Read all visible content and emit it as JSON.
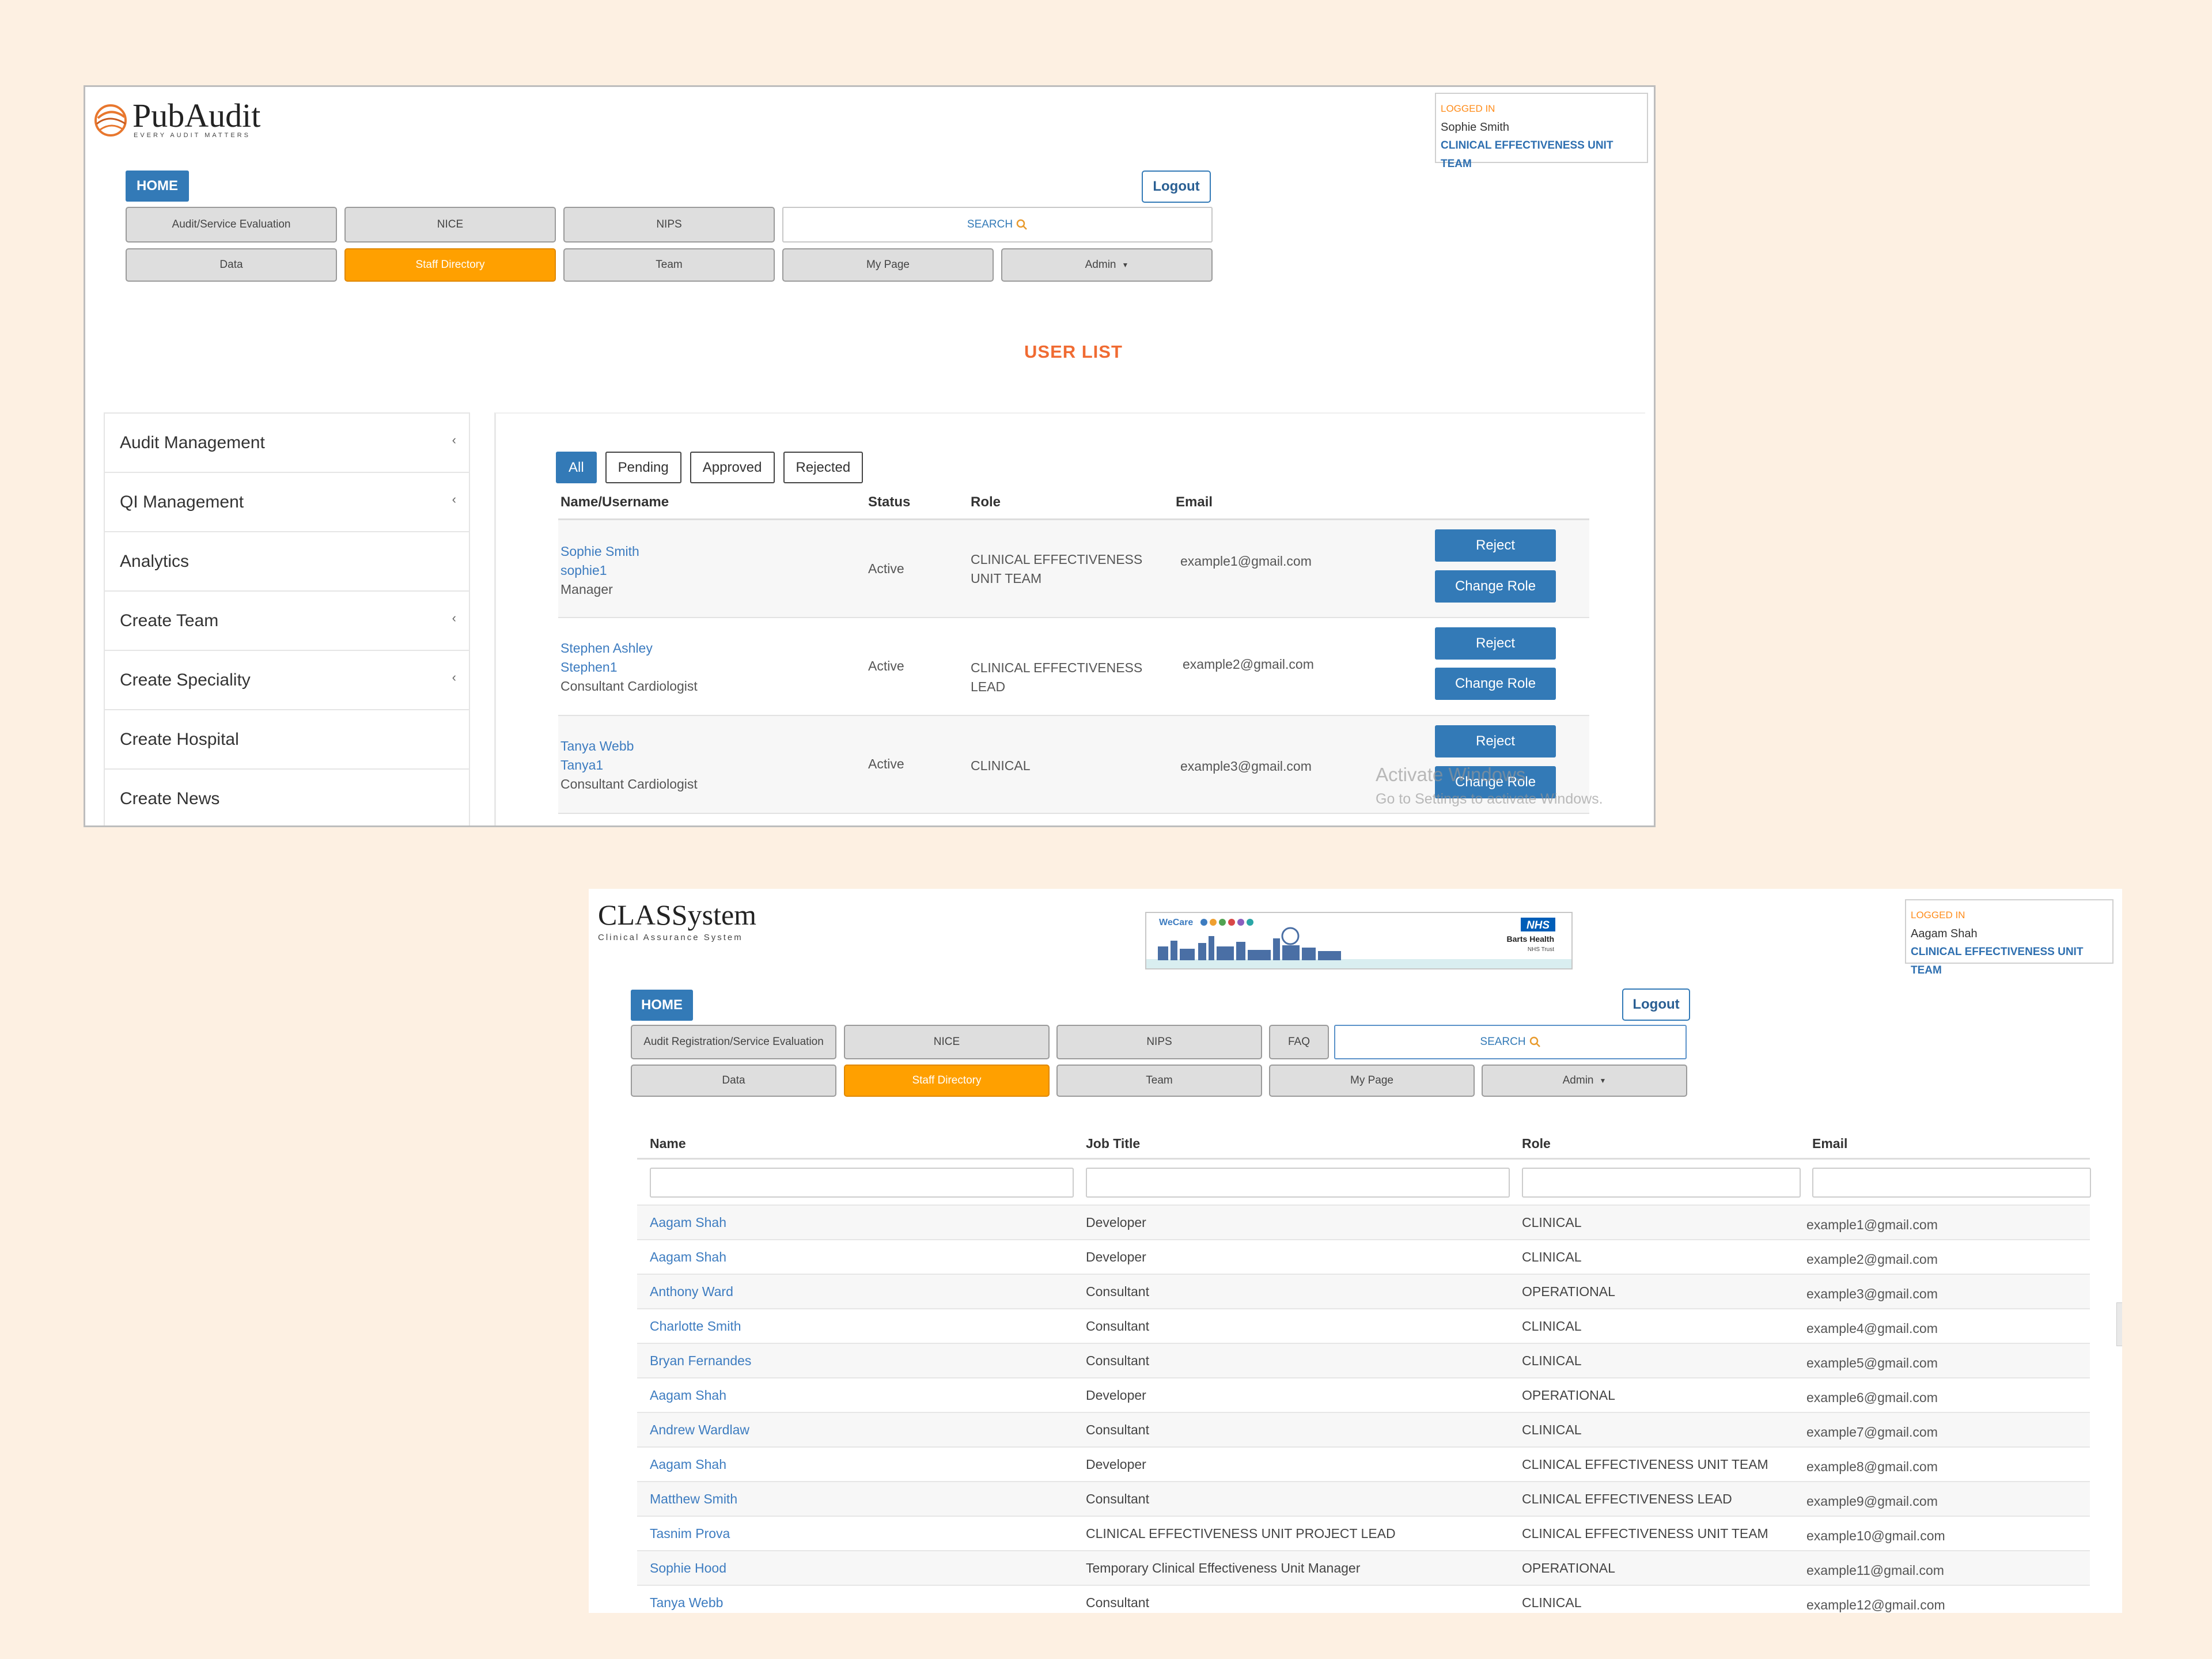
{
  "pubaudit": {
    "brand": {
      "name": "PubAudit",
      "tagline": "EVERY AUDIT MATTERS"
    },
    "logged_in": {
      "label": "LOGGED IN",
      "user": "Sophie Smith",
      "team": "CLINICAL EFFECTIVENESS UNIT TEAM"
    },
    "nav": {
      "home": "HOME",
      "logout": "Logout",
      "row1": [
        "Audit/Service Evaluation",
        "NICE",
        "NIPS"
      ],
      "search": "SEARCH",
      "row2": [
        "Data",
        "Staff Directory",
        "Team",
        "My Page",
        "Admin"
      ],
      "active": "Staff Directory"
    },
    "page_title": "USER LIST",
    "sidebar": [
      "Audit Management",
      "QI Management",
      "Analytics",
      "Create Team",
      "Create Speciality",
      "Create Hospital",
      "Create News"
    ],
    "filters": [
      "All",
      "Pending",
      "Approved",
      "Rejected"
    ],
    "active_filter": "All",
    "columns": [
      "Name/Username",
      "Status",
      "Role",
      "Email"
    ],
    "users": [
      {
        "name": "Sophie Smith",
        "username": "sophie1",
        "title": "Manager",
        "status": "Active",
        "role": "CLINICAL EFFECTIVENESS UNIT TEAM",
        "email": "example1@gmail.com"
      },
      {
        "name": "Stephen Ashley",
        "username": "Stephen1",
        "title": "Consultant Cardiologist",
        "status": "Active",
        "role": "CLINICAL EFFECTIVENESS LEAD",
        "email": "example2@gmail.com"
      },
      {
        "name": "Tanya Webb",
        "username": "Tanya1",
        "title": "Consultant Cardiologist",
        "status": "Active",
        "role": "CLINICAL",
        "email": "example3@gmail.com"
      }
    ],
    "actions": {
      "reject": "Reject",
      "change_role": "Change Role"
    },
    "watermark": {
      "line1": "Activate Windows",
      "line2": "Go to Settings to activate Windows."
    }
  },
  "classystem": {
    "brand": {
      "name": "CLASSystem",
      "tagline": "Clinical Assurance System"
    },
    "banner": {
      "left": "WeCare",
      "org": "NHS",
      "trust": "Barts Health",
      "trust_sub": "NHS Trust"
    },
    "logged_in": {
      "label": "LOGGED IN",
      "user": "Aagam Shah",
      "team": "CLINICAL EFFECTIVENESS UNIT TEAM"
    },
    "nav": {
      "home": "HOME",
      "logout": "Logout",
      "row1": [
        "Audit Registration/Service Evaluation",
        "NICE",
        "NIPS",
        "FAQ"
      ],
      "search": "SEARCH",
      "row2": [
        "Data",
        "Staff Directory",
        "Team",
        "My Page",
        "Admin"
      ],
      "active": "Staff Directory"
    },
    "columns": [
      "Name",
      "Job Title",
      "Role",
      "Email"
    ],
    "rows": [
      {
        "name": "Aagam Shah",
        "job": "Developer",
        "role": "CLINICAL",
        "email": "example1@gmail.com"
      },
      {
        "name": "Aagam Shah",
        "job": "Developer",
        "role": "CLINICAL",
        "email": "example2@gmail.com"
      },
      {
        "name": "Anthony Ward",
        "job": "Consultant",
        "role": "OPERATIONAL",
        "email": "example3@gmail.com"
      },
      {
        "name": "Charlotte Smith",
        "job": "Consultant",
        "role": "CLINICAL",
        "email": "example4@gmail.com"
      },
      {
        "name": "Bryan Fernandes",
        "job": "Consultant",
        "role": "CLINICAL",
        "email": "example5@gmail.com"
      },
      {
        "name": "Aagam Shah",
        "job": "Developer",
        "role": "OPERATIONAL",
        "email": "example6@gmail.com"
      },
      {
        "name": "Andrew Wardlaw",
        "job": "Consultant",
        "role": "CLINICAL",
        "email": "example7@gmail.com"
      },
      {
        "name": "Aagam Shah",
        "job": "Developer",
        "role": "CLINICAL EFFECTIVENESS UNIT TEAM",
        "email": "example8@gmail.com"
      },
      {
        "name": "Matthew Smith",
        "job": "Consultant",
        "role": "CLINICAL EFFECTIVENESS LEAD",
        "email": "example9@gmail.com"
      },
      {
        "name": "Tasnim Prova",
        "job": "CLINICAL EFFECTIVENESS UNIT PROJECT LEAD",
        "role": "CLINICAL EFFECTIVENESS UNIT TEAM",
        "email": "example10@gmail.com"
      },
      {
        "name": "Sophie Hood",
        "job": "Temporary Clinical Effectiveness Unit Manager",
        "role": "OPERATIONAL",
        "email": "example11@gmail.com"
      },
      {
        "name": "Tanya Webb",
        "job": "Consultant",
        "role": "CLINICAL",
        "email": "example12@gmail.com"
      }
    ]
  },
  "colors": {
    "primary": "#337ab7",
    "accent_orange": "#ffa000",
    "title_orange": "#f06b32",
    "link": "#3d7cc0",
    "background": "#fdf0e2"
  }
}
